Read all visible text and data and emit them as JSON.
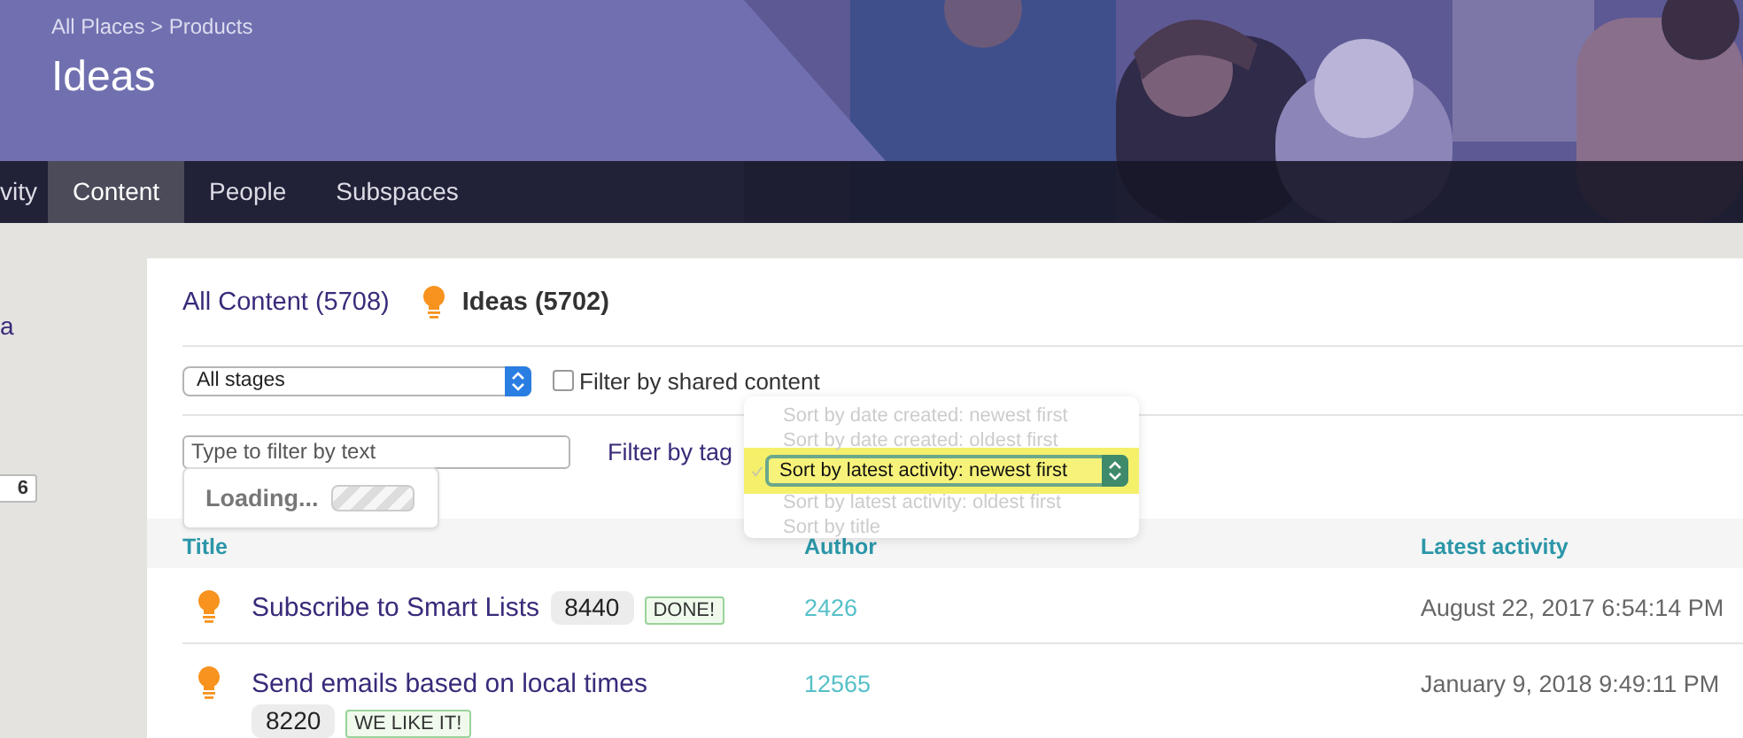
{
  "breadcrumb": "All Places > Products",
  "title": "Ideas",
  "nav": [
    {
      "label": "vity",
      "selected": false
    },
    {
      "label": "Content",
      "selected": true
    },
    {
      "label": "People",
      "selected": false
    },
    {
      "label": "Subspaces",
      "selected": false
    }
  ],
  "sidebar": {
    "link": "a",
    "count": "6"
  },
  "content_tabs": [
    {
      "label": "All Content (5708)",
      "selected": false
    },
    {
      "label": "Ideas (5702)",
      "selected": true
    }
  ],
  "stage_filter": {
    "value": "All stages"
  },
  "shared_filter": {
    "label": "Filter by shared content",
    "checked": false
  },
  "text_filter": {
    "placeholder": "Type to filter by text"
  },
  "tag_filter": {
    "label": "Filter by tag"
  },
  "sort_menu": {
    "options": [
      {
        "label": "Sort by date created: newest first",
        "selected": false
      },
      {
        "label": "Sort by date created: oldest first",
        "selected": false
      },
      {
        "label": "Sort by latest activity: newest first",
        "selected": true
      },
      {
        "label": "Sort by latest activity: oldest first",
        "selected": false
      },
      {
        "label": "Sort by title",
        "selected": false
      }
    ]
  },
  "loading": {
    "label": "Loading..."
  },
  "table": {
    "columns": [
      "Title",
      "Author",
      "Latest activity"
    ],
    "rows": [
      {
        "title": "Subscribe to Smart Lists",
        "votes": "8440",
        "status": "DONE!",
        "author": "2426",
        "latest_activity": "August 22, 2017 6:54:14 PM"
      },
      {
        "title": "Send emails based on local times",
        "votes": "8220",
        "status": "WE LIKE IT!",
        "author": "12565",
        "latest_activity": "January 9, 2018 9:49:11 PM"
      }
    ]
  }
}
